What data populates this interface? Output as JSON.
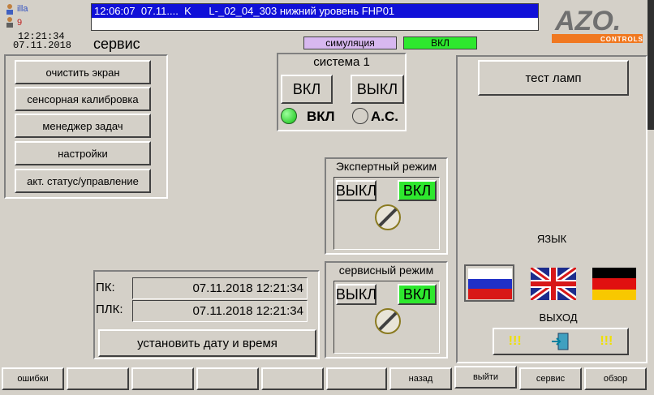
{
  "header": {
    "user": "illa",
    "user_level": "9",
    "time": "12:21:34",
    "date": "07.11.2018",
    "screen_title": "сервис",
    "alarm_line": "12:06:07  07.11....  K      L-_02_04_303 нижний уровень FHP01",
    "mode_simulation": "симуляция",
    "mode_on": "ВКЛ",
    "logo_text": "AZO",
    "logo_sub": "CONTROLS"
  },
  "menu": {
    "items": [
      {
        "label": "очистить экран"
      },
      {
        "label": "сенсорная калибровка"
      },
      {
        "label": "менеджер задач"
      },
      {
        "label": "настройки"
      },
      {
        "label": "акт. статус/управление"
      }
    ]
  },
  "system1": {
    "title": "система 1",
    "on_label": "ВКЛ",
    "off_label": "ВЫКЛ",
    "status_on": "ВКЛ",
    "status_ac": "А.С."
  },
  "expert": {
    "title": "Экспертный режим",
    "off_label": "ВЫКЛ",
    "on_label": "ВКЛ"
  },
  "service": {
    "title": "сервисный режим",
    "off_label": "ВЫКЛ",
    "on_label": "ВКЛ"
  },
  "datetime": {
    "pc_label": "ПК:",
    "pc_value": "07.11.2018 12:21:34",
    "plc_label": "ПЛК:",
    "plc_value": "07.11.2018 12:21:34",
    "set_button": "установить дату и время"
  },
  "right": {
    "lamp_test": "тест ламп",
    "language": "ЯЗЫК",
    "exit": "ВЫХОД",
    "exclaim": "!!!"
  },
  "bottom": {
    "errors": "ошибки",
    "back": "назад",
    "logout": "выйти",
    "service": "сервис",
    "overview": "обзор"
  },
  "colors": {
    "alarm_bg": "#1010d8",
    "on_green": "#2ee82e",
    "simulation_bg": "#d8b8f0",
    "logo_orange": "#f07820"
  }
}
